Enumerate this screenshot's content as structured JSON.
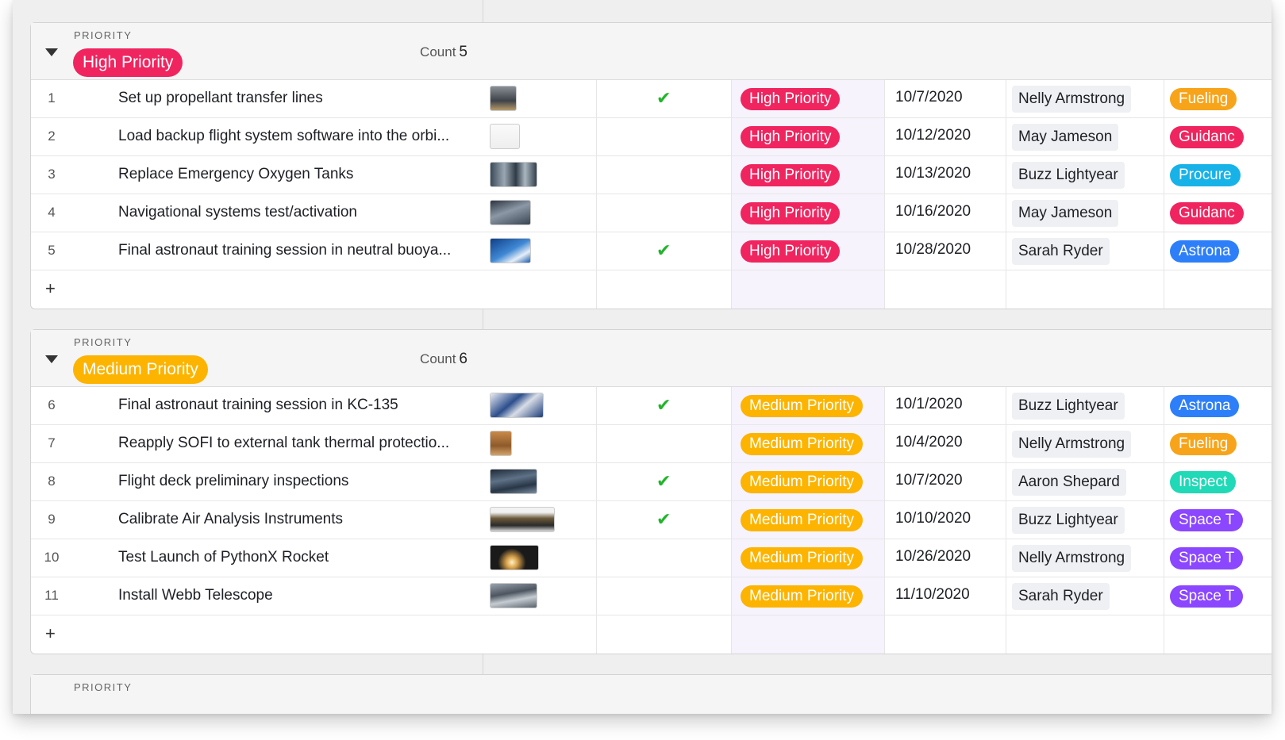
{
  "groups": [
    {
      "label": "PRIORITY",
      "value": "High Priority",
      "color": "#f0255f",
      "count_label": "Count",
      "count": "5",
      "add_label": "+",
      "rows": [
        {
          "num": "1",
          "title": "Set up propellant transfer lines",
          "thumb": "rocket-image",
          "check": true,
          "priority": "High Priority",
          "date": "10/7/2020",
          "assignee": "Nelly Armstrong",
          "category": "Fueling",
          "category_color": "#f7a41a"
        },
        {
          "num": "2",
          "title": "Load backup flight system software into the orbi...",
          "thumb": "document-image",
          "check": false,
          "priority": "High Priority",
          "date": "10/12/2020",
          "assignee": "May Jameson",
          "category": "Guidanc",
          "category_color": "#f0255f"
        },
        {
          "num": "3",
          "title": "Replace Emergency Oxygen Tanks",
          "thumb": "tanks-image",
          "check": false,
          "priority": "High Priority",
          "date": "10/13/2020",
          "assignee": "Buzz Lightyear",
          "category": "Procure",
          "category_color": "#17b2e8"
        },
        {
          "num": "4",
          "title": "Navigational systems test/activation",
          "thumb": "navigation-image",
          "check": false,
          "priority": "High Priority",
          "date": "10/16/2020",
          "assignee": "May Jameson",
          "category": "Guidanc",
          "category_color": "#f0255f"
        },
        {
          "num": "5",
          "title": "Final astronaut training session in neutral buoya...",
          "thumb": "underwater-image",
          "check": true,
          "priority": "High Priority",
          "date": "10/28/2020",
          "assignee": "Sarah Ryder",
          "category": "Astrona",
          "category_color": "#2d7ff9"
        }
      ]
    },
    {
      "label": "PRIORITY",
      "value": "Medium Priority",
      "color": "#fcb400",
      "count_label": "Count",
      "count": "6",
      "add_label": "+",
      "rows": [
        {
          "num": "6",
          "title": "Final astronaut training session in KC-135",
          "thumb": "zero-g-image",
          "check": true,
          "priority": "Medium Priority",
          "date": "10/1/2020",
          "assignee": "Buzz Lightyear",
          "category": "Astrona",
          "category_color": "#2d7ff9"
        },
        {
          "num": "7",
          "title": "Reapply SOFI to external tank thermal protectio...",
          "thumb": "external-tank-image",
          "check": false,
          "priority": "Medium Priority",
          "date": "10/4/2020",
          "assignee": "Nelly Armstrong",
          "category": "Fueling",
          "category_color": "#f7a41a"
        },
        {
          "num": "8",
          "title": "Flight deck preliminary inspections",
          "thumb": "flight-deck-image",
          "check": true,
          "priority": "Medium Priority",
          "date": "10/7/2020",
          "assignee": "Aaron Shepard",
          "category": "Inspect",
          "category_color": "#20d9b6"
        },
        {
          "num": "9",
          "title": "Calibrate Air Analysis Instruments",
          "thumb": "instrument-image",
          "check": true,
          "priority": "Medium Priority",
          "date": "10/10/2020",
          "assignee": "Buzz Lightyear",
          "category": "Space T",
          "category_color": "#8b46ff"
        },
        {
          "num": "10",
          "title": "Test Launch of PythonX Rocket",
          "thumb": "launch-image",
          "check": false,
          "priority": "Medium Priority",
          "date": "10/26/2020",
          "assignee": "Nelly Armstrong",
          "category": "Space T",
          "category_color": "#8b46ff"
        },
        {
          "num": "11",
          "title": "Install Webb Telescope",
          "thumb": "telescope-image",
          "check": false,
          "priority": "Medium Priority",
          "date": "11/10/2020",
          "assignee": "Sarah Ryder",
          "category": "Space T",
          "category_color": "#8b46ff"
        }
      ]
    },
    {
      "label": "PRIORITY"
    }
  ],
  "check_glyph": "✔"
}
